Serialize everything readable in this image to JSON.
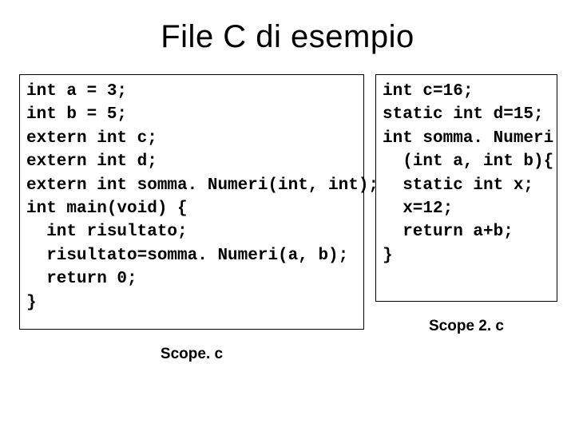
{
  "title": "File C di esempio",
  "left": {
    "label": "Scope. c",
    "lines": [
      "int a = 3;",
      "int b = 5;",
      "extern int c;",
      "extern int d;",
      "extern int somma. Numeri(int, int);",
      "int main(void) {",
      "  int risultato;",
      "  risultato=somma. Numeri(a, b);",
      "  return 0;",
      "}"
    ]
  },
  "right": {
    "label": "Scope 2. c",
    "lines": [
      "int c=16;",
      "static int d=15;",
      "int somma. Numeri",
      "  (int a, int b){",
      "  static int x;",
      "  x=12;",
      "  return a+b;",
      "}"
    ]
  }
}
